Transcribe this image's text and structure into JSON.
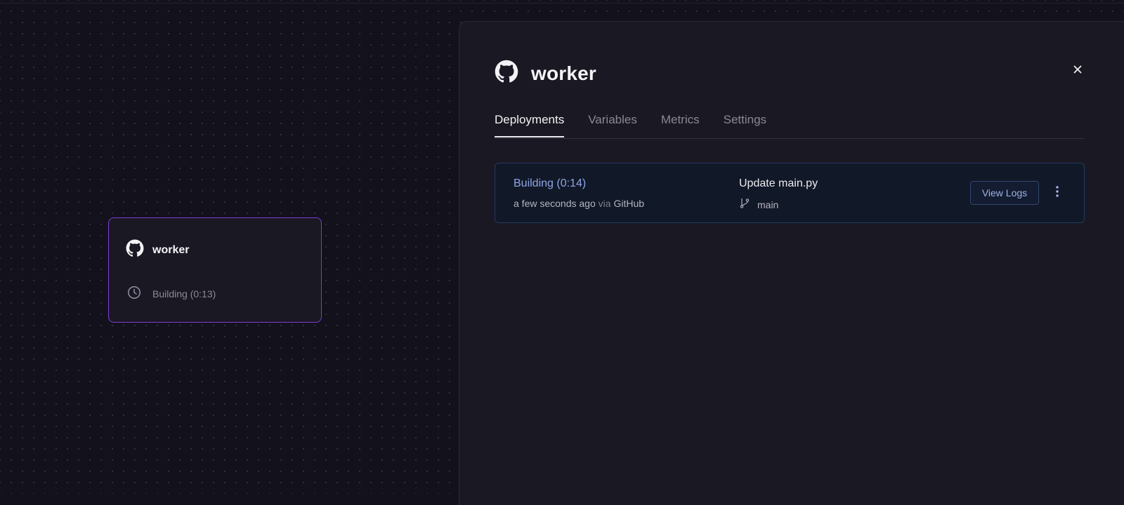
{
  "canvas": {
    "service_card": {
      "icon": "github-icon",
      "title": "worker",
      "status_icon": "clock-icon",
      "status": "Building (0:13)"
    }
  },
  "panel": {
    "icon": "github-icon",
    "title": "worker",
    "close_icon": "close-icon",
    "tabs": [
      {
        "label": "Deployments",
        "active": true
      },
      {
        "label": "Variables",
        "active": false
      },
      {
        "label": "Metrics",
        "active": false
      },
      {
        "label": "Settings",
        "active": false
      }
    ],
    "deployment": {
      "status": "Building (0:14)",
      "time": "a few seconds ago",
      "via_label": "via",
      "source": "GitHub",
      "commit_message": "Update main.py",
      "branch_icon": "git-branch-icon",
      "branch": "main",
      "view_logs_label": "View Logs",
      "more_icon": "more-vertical-icon"
    }
  },
  "colors": {
    "background": "#13111c",
    "panel": "#1a1822",
    "card_border_selected": "#7b3fd3",
    "deploy_border": "#213a63",
    "status_building": "#8fa6e6"
  }
}
